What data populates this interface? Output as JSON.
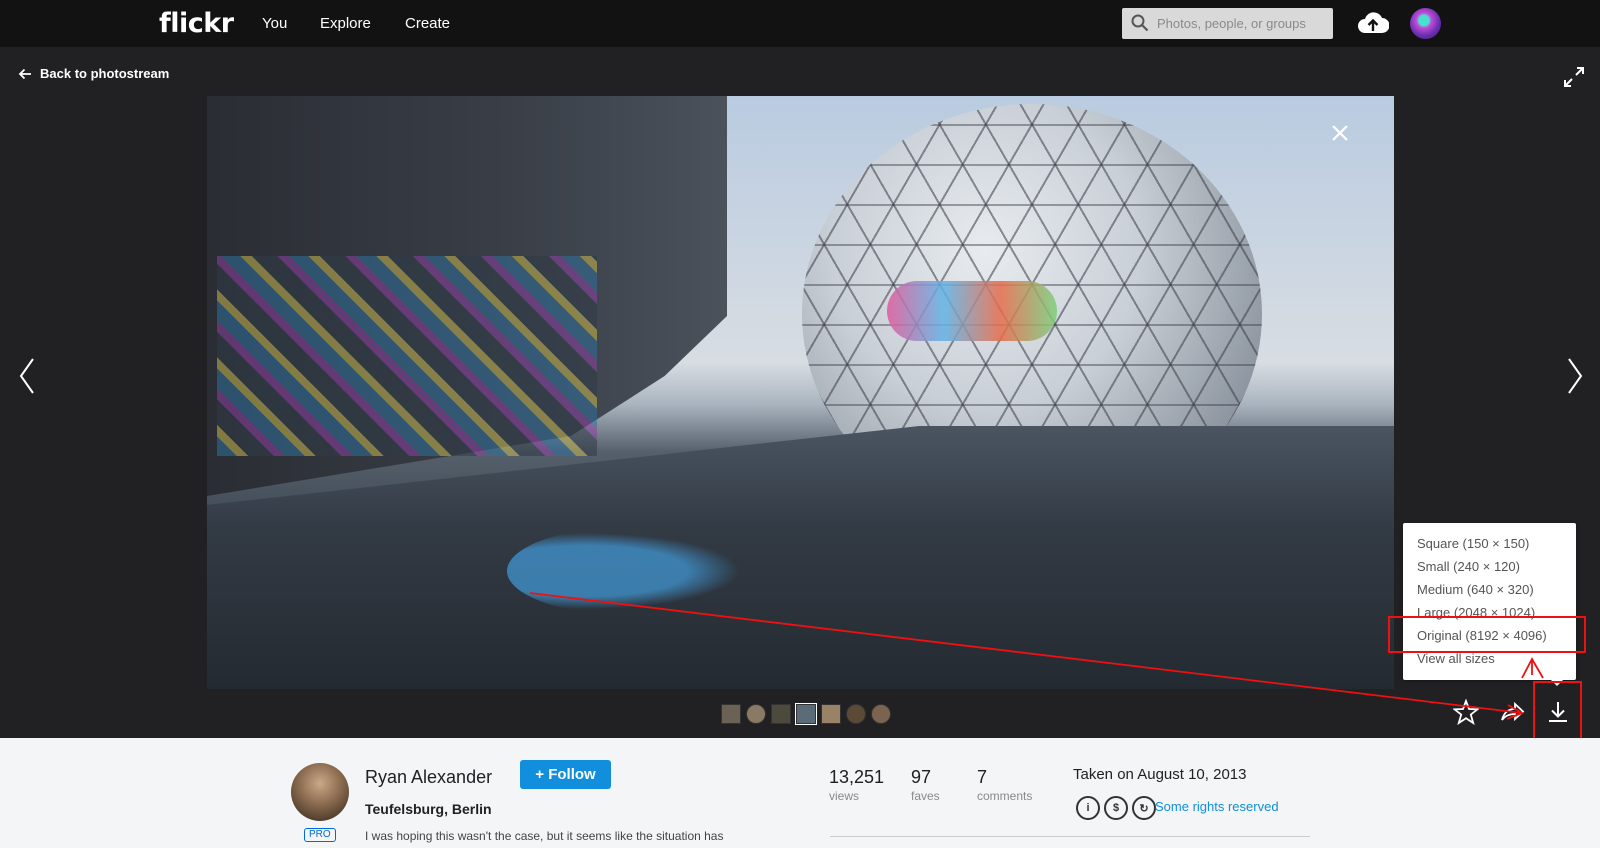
{
  "nav": {
    "logo": "flickr",
    "links": [
      "You",
      "Explore",
      "Create"
    ],
    "search_placeholder": "Photos, people, or groups"
  },
  "viewer": {
    "back_label": "Back to photostream",
    "download_menu": [
      "Square (150 × 150)",
      "Small (240 × 120)",
      "Medium (640 × 320)",
      "Large (2048 × 1024)",
      "Original (8192 × 4096)",
      "View all sizes"
    ],
    "thumbnail_count": 7,
    "selected_thumbnail": 4
  },
  "photo_info": {
    "owner": "Ryan Alexander",
    "pro_badge": "PRO",
    "follow_label": "+ Follow",
    "title": "Teufelsburg, Berlin",
    "description": "I was hoping this wasn't the case, but it seems like the situation has",
    "stats": [
      {
        "value": "13,251",
        "label": "views"
      },
      {
        "value": "97",
        "label": "faves"
      },
      {
        "value": "7",
        "label": "comments"
      }
    ],
    "taken": "Taken on August 10, 2013",
    "license": "Some rights reserved"
  },
  "colors": {
    "accent": "#128fdc",
    "annotation": "#ee1111",
    "viewer_bg": "#212124"
  }
}
